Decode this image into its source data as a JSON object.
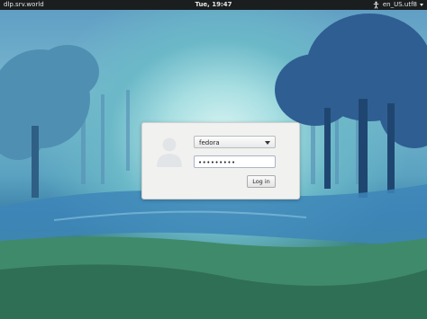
{
  "topbar": {
    "hostname": "dlp.srv.world",
    "clock": "Tue, 19:47",
    "input_language": "en_US.utf8"
  },
  "login": {
    "username": "fedora",
    "password_mask": "•••••••••",
    "login_button": "Log in"
  },
  "icons": [
    "accessibility-icon",
    "user-avatar-icon",
    "dropdown-caret-icon"
  ]
}
